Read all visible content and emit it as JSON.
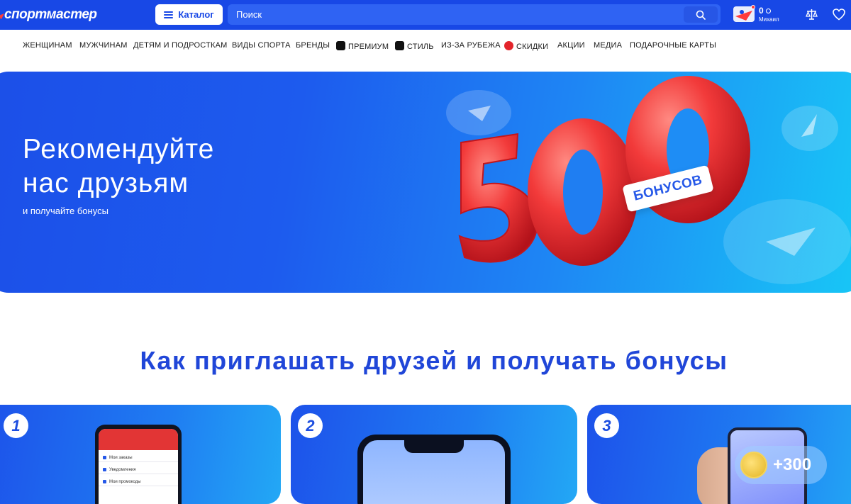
{
  "header": {
    "logo_text": "спортмастер",
    "catalog_label": "Каталог",
    "search_placeholder": "Поиск",
    "user": {
      "points": "0",
      "name": "Михаил"
    }
  },
  "nav": {
    "items": [
      {
        "label": "ЖЕНЩИНАМ"
      },
      {
        "label": "МУЖЧИНАМ"
      },
      {
        "label": "ДЕТЯМ И ПОДРОСТКАМ"
      },
      {
        "label": "ВИДЫ СПОРТА"
      },
      {
        "label": "БРЕНДЫ"
      },
      {
        "label": "ПРЕМИУМ",
        "badge_color": "#111111"
      },
      {
        "label": "СТИЛЬ",
        "badge_color": "#111111"
      },
      {
        "label": "ИЗ-ЗА РУБЕЖА"
      },
      {
        "label": "СКИДКИ",
        "badge_color": "#e3242b"
      },
      {
        "label": "АКЦИИ"
      },
      {
        "label": "МЕДИА"
      },
      {
        "label": "ПОДАРОЧНЫЕ КАРТЫ"
      }
    ]
  },
  "hero": {
    "title_line1": "Рекомендуйте",
    "title_line2": "нас друзьям",
    "subtitle": "и получайте бонусы",
    "big_number": "500",
    "tag": "БОНУСОВ"
  },
  "section": {
    "title": "Как приглашать друзей и получать бонусы"
  },
  "steps": [
    {
      "number": "1",
      "menu": [
        "Мои заказы",
        "Уведомления",
        "Мои промокоды"
      ]
    },
    {
      "number": "2"
    },
    {
      "number": "3",
      "bonus": "+300"
    }
  ],
  "colors": {
    "brand_blue": "#1848e6",
    "accent_red": "#f0383f",
    "heading_blue": "#2046d8"
  }
}
